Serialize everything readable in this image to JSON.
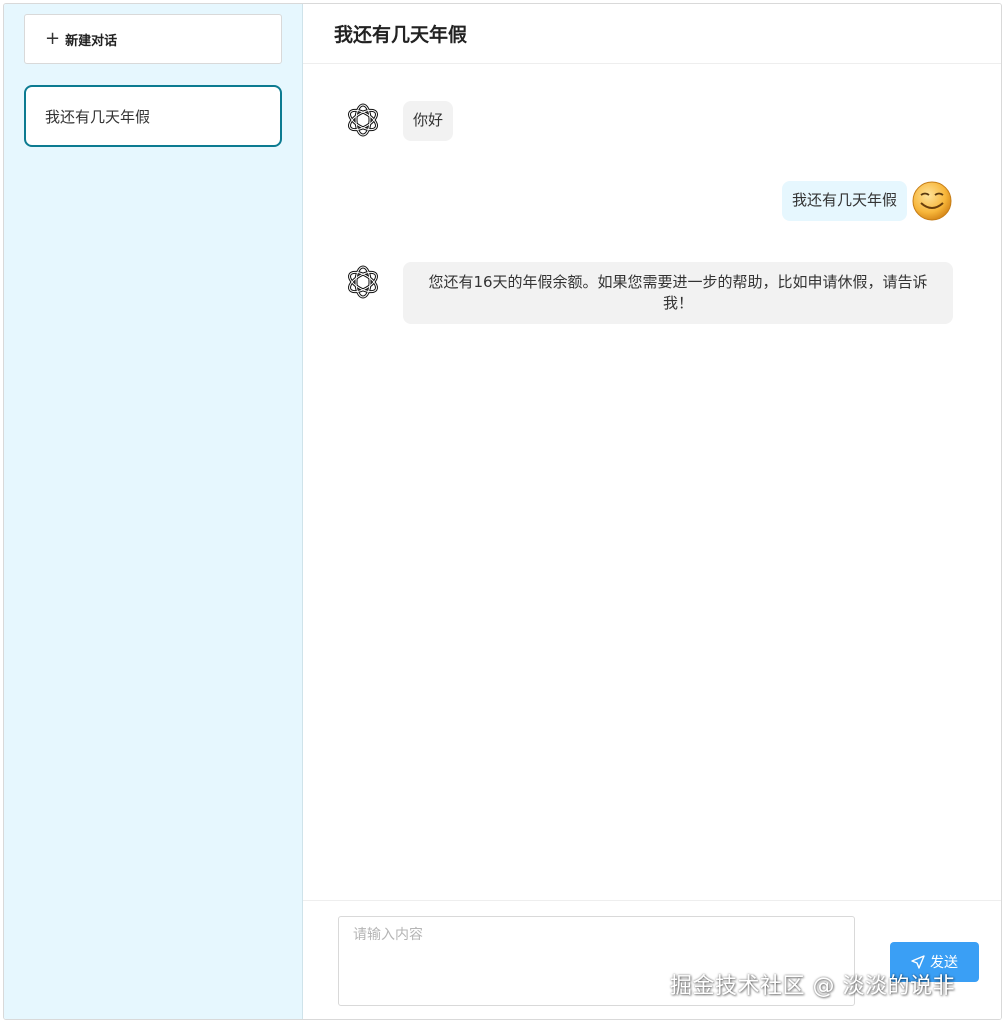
{
  "sidebar": {
    "new_chat_label": "新建对话",
    "new_chat_icon": "plus-icon",
    "conversations": [
      {
        "title": "我还有几天年假",
        "active": true
      }
    ]
  },
  "header": {
    "title": "我还有几天年假"
  },
  "messages": [
    {
      "role": "assistant",
      "avatar": "openai-logo-icon",
      "text": "你好"
    },
    {
      "role": "user",
      "avatar": "smiley-face-avatar",
      "text": "我还有几天年假"
    },
    {
      "role": "assistant",
      "avatar": "openai-logo-icon",
      "text": "您还有16天的年假余额。如果您需要进一步的帮助，比如申请休假，请告诉我！"
    }
  ],
  "composer": {
    "placeholder": "请输入内容",
    "value": "",
    "send_label": "发送",
    "send_icon": "send-arrow-icon"
  },
  "watermark": "掘金技术社区 @ 淡淡的说非",
  "colors": {
    "sidebar_bg": "#e6f7fe",
    "active_border": "#0c7b91",
    "bot_bubble": "#f2f2f2",
    "user_bubble": "#e6f7fe",
    "send_button": "#3a9ff5"
  }
}
